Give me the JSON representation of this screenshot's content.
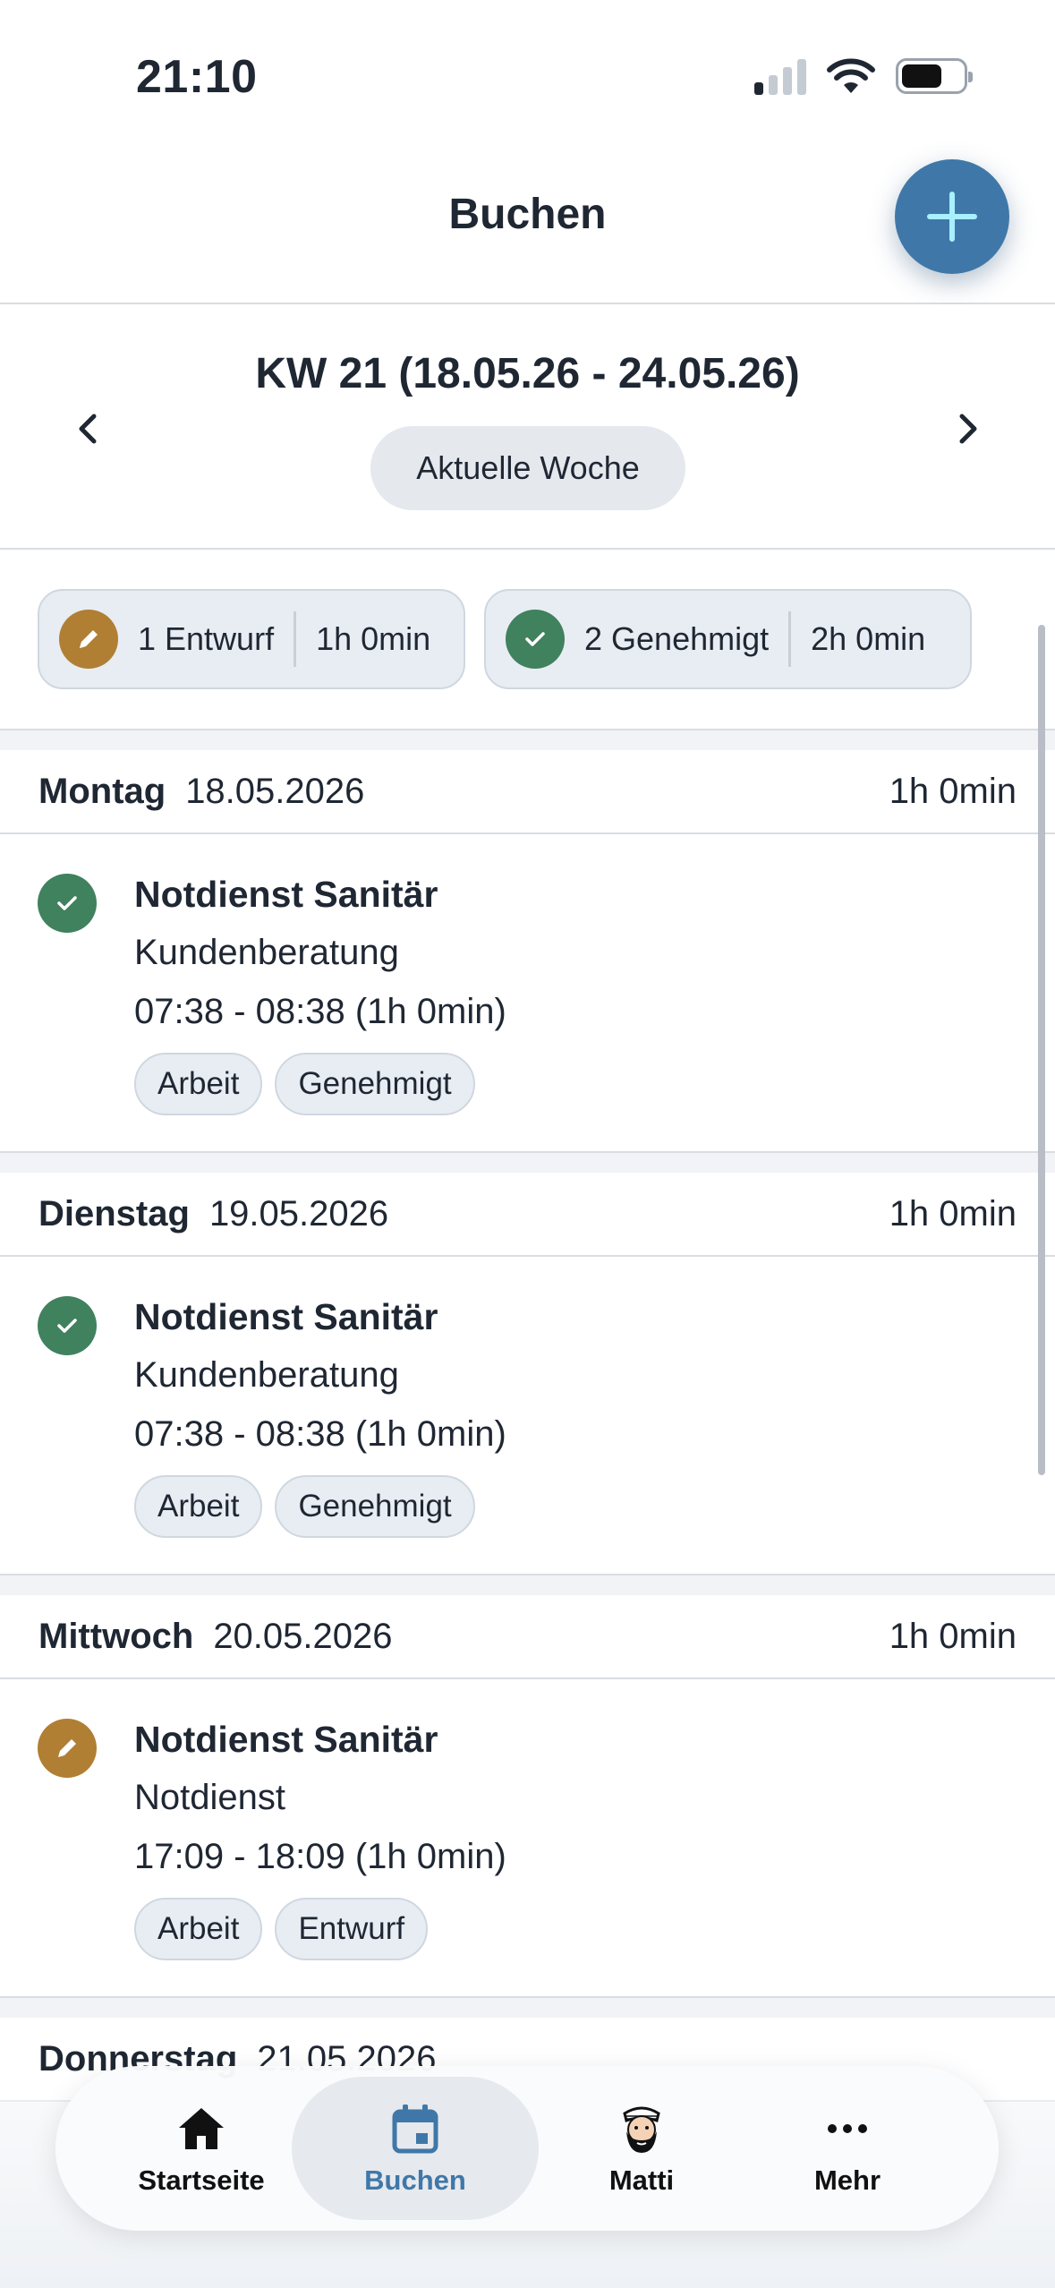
{
  "status_bar": {
    "time": "21:10",
    "icons": [
      "signal-icon",
      "wifi-icon",
      "battery-icon"
    ]
  },
  "header": {
    "title": "Buchen",
    "add_button_icon": "plus-icon"
  },
  "week_nav": {
    "title": "KW 21 (18.05.26 - 24.05.26)",
    "current_week_label": "Aktuelle Woche",
    "prev_icon": "chevron-left-icon",
    "next_icon": "chevron-right-icon"
  },
  "summary": {
    "draft": {
      "count_label": "1 Entwurf",
      "duration": "1h 0min",
      "icon": "pencil-icon",
      "color": "#b07f34"
    },
    "approved": {
      "count_label": "2 Genehmigt",
      "duration": "2h 0min",
      "icon": "check-icon",
      "color": "#40815e"
    }
  },
  "days": [
    {
      "name": "Montag",
      "date": "18.05.2026",
      "total": "1h 0min",
      "entry": {
        "status": "approved",
        "title": "Notdienst Sanitär",
        "activity": "Kundenberatung",
        "time": "07:38 - 08:38 (1h 0min)",
        "tags": [
          "Arbeit",
          "Genehmigt"
        ]
      }
    },
    {
      "name": "Dienstag",
      "date": "19.05.2026",
      "total": "1h 0min",
      "entry": {
        "status": "approved",
        "title": "Notdienst Sanitär",
        "activity": "Kundenberatung",
        "time": "07:38 - 08:38 (1h 0min)",
        "tags": [
          "Arbeit",
          "Genehmigt"
        ]
      }
    },
    {
      "name": "Mittwoch",
      "date": "20.05.2026",
      "total": "1h 0min",
      "entry": {
        "status": "draft",
        "title": "Notdienst Sanitär",
        "activity": "Notdienst",
        "time": "17:09 - 18:09 (1h 0min)",
        "tags": [
          "Arbeit",
          "Entwurf"
        ]
      }
    },
    {
      "name": "Donnerstag",
      "date": "21.05.2026"
    }
  ],
  "tabbar": {
    "items": [
      {
        "label": "Startseite",
        "icon": "home-icon",
        "active": false
      },
      {
        "label": "Buchen",
        "icon": "calendar-icon",
        "active": true
      },
      {
        "label": "Matti",
        "icon": "avatar-icon",
        "active": false
      },
      {
        "label": "Mehr",
        "icon": "more-icon",
        "active": false
      }
    ]
  },
  "colors": {
    "accent": "#3f78a8",
    "draft": "#b07f34",
    "approved": "#40815e"
  }
}
